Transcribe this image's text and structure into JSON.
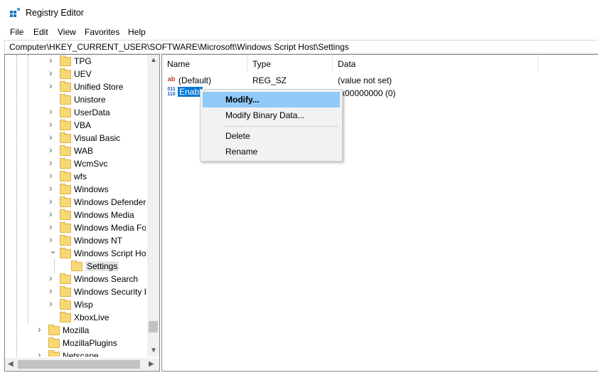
{
  "window": {
    "title": "Registry Editor",
    "icon": "regedit-icon"
  },
  "menu": [
    "File",
    "Edit",
    "View",
    "Favorites",
    "Help"
  ],
  "address": "Computer\\HKEY_CURRENT_USER\\SOFTWARE\\Microsoft\\Windows Script Host\\Settings",
  "tree": {
    "items": [
      {
        "label": "TPG",
        "expand": "collapsed"
      },
      {
        "label": "UEV",
        "expand": "collapsed"
      },
      {
        "label": "Unified Store",
        "expand": "collapsed"
      },
      {
        "label": "Unistore",
        "expand": "none"
      },
      {
        "label": "UserData",
        "expand": "collapsed"
      },
      {
        "label": "VBA",
        "expand": "collapsed"
      },
      {
        "label": "Visual Basic",
        "expand": "collapsed"
      },
      {
        "label": "WAB",
        "expand": "collapsed"
      },
      {
        "label": "WcmSvc",
        "expand": "collapsed"
      },
      {
        "label": "wfs",
        "expand": "collapsed"
      },
      {
        "label": "Windows",
        "expand": "collapsed"
      },
      {
        "label": "Windows Defender Sec",
        "expand": "collapsed"
      },
      {
        "label": "Windows Media",
        "expand": "collapsed"
      },
      {
        "label": "Windows Media Founc",
        "expand": "collapsed"
      },
      {
        "label": "Windows NT",
        "expand": "collapsed"
      },
      {
        "label": "Windows Script Host",
        "expand": "expanded"
      },
      {
        "label": "Settings",
        "expand": "none",
        "selected": true
      },
      {
        "label": "Windows Search",
        "expand": "collapsed"
      },
      {
        "label": "Windows Security Hea",
        "expand": "collapsed"
      },
      {
        "label": "Wisp",
        "expand": "collapsed"
      },
      {
        "label": "XboxLive",
        "expand": "none"
      },
      {
        "label": "Mozilla",
        "expand": "collapsed"
      },
      {
        "label": "MozillaPlugins",
        "expand": "none"
      },
      {
        "label": "Netscape",
        "expand": "collapsed"
      }
    ]
  },
  "values": {
    "columns": [
      "Name",
      "Type",
      "Data"
    ],
    "rows": [
      {
        "name": "(Default)",
        "type": "REG_SZ",
        "data": "(value not set)",
        "icon": "string-value-icon"
      },
      {
        "name": "Enabl",
        "type": "",
        "data": "x00000000 (0)",
        "icon": "dword-value-icon"
      }
    ]
  },
  "context_menu": {
    "items": [
      "Modify...",
      "Modify Binary Data...",
      "Delete",
      "Rename"
    ]
  },
  "colors": {
    "selection": "#0078d7",
    "menu_hover": "#91c9f7",
    "folder": "#f8d775"
  }
}
